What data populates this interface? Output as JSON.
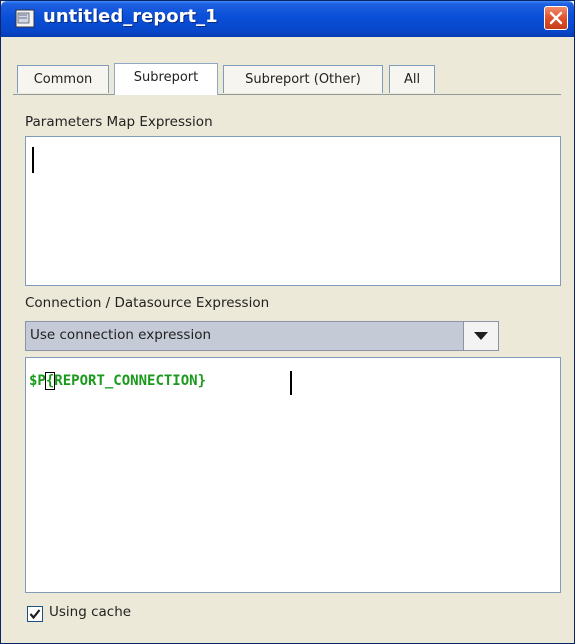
{
  "window": {
    "title": "untitled_report_1",
    "title_icon": "document-icon",
    "close_icon": "close-icon"
  },
  "tabs": [
    {
      "label": "Common",
      "active": false
    },
    {
      "label": "Subreport",
      "active": true
    },
    {
      "label": "Subreport (Other)",
      "active": false
    },
    {
      "label": "All",
      "active": false
    }
  ],
  "parameters_map": {
    "label": "Parameters Map Expression",
    "value": ""
  },
  "connection": {
    "label": "Connection / Datasource Expression",
    "selected": "Use connection expression",
    "dropdown_icon": "chevron-down-icon",
    "expression_prefix": "$P",
    "expression_brace": "{",
    "expression_rest": "REPORT_CONNECTION}"
  },
  "using_cache": {
    "label": "Using cache",
    "checked": true
  },
  "colors": {
    "titlebar": "#0a4fd8",
    "expression_text": "#1a9a1a",
    "combo_background": "#c4cad6",
    "close_button": "#e2512c"
  }
}
